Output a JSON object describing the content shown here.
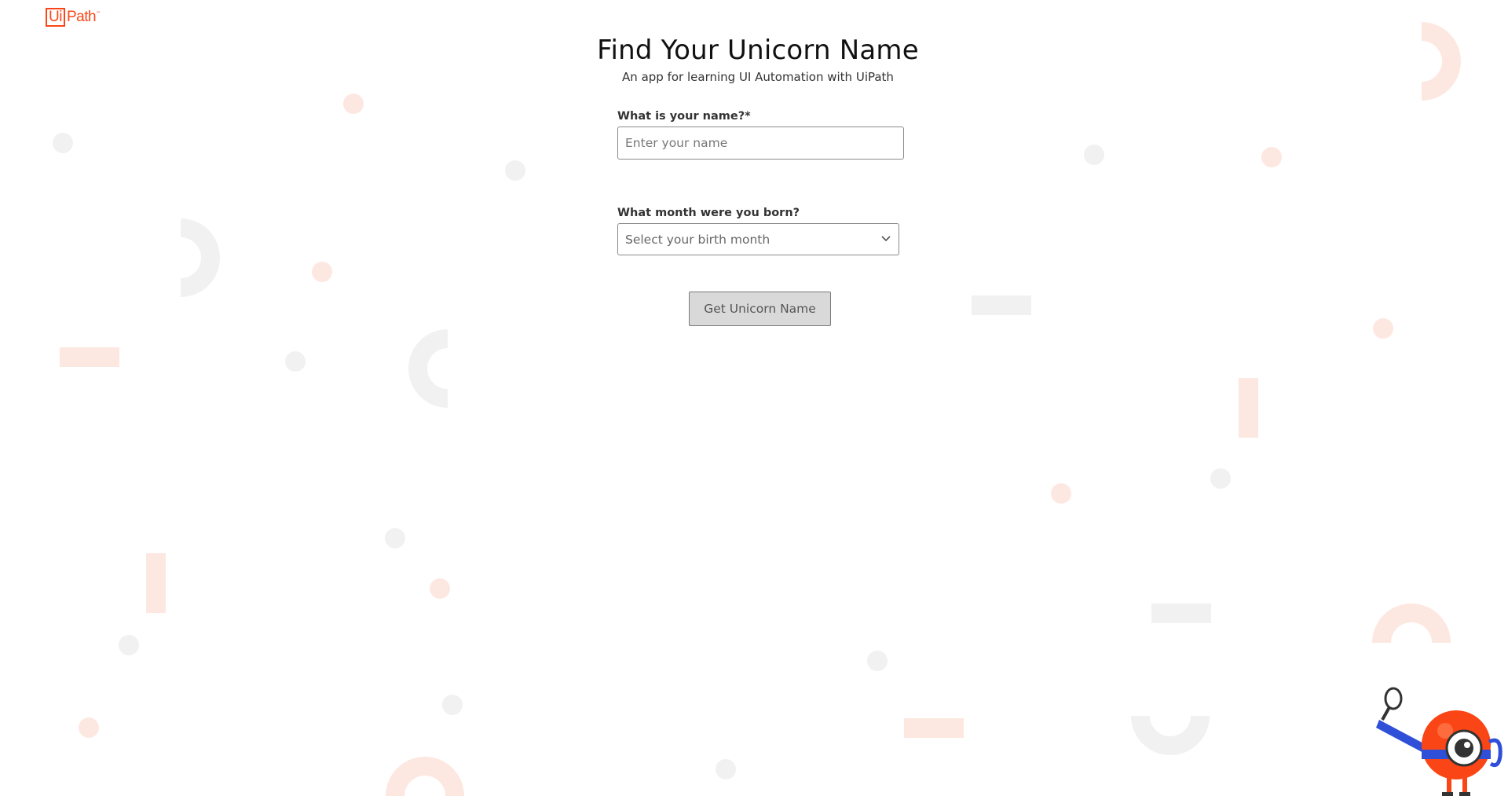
{
  "brand": {
    "logo_box_text": "Ui",
    "logo_text": "Path",
    "logo_tm": "™",
    "accent_color": "#fa4616"
  },
  "header": {
    "title": "Find Your Unicorn Name",
    "subtitle": "An app for learning UI Automation with UiPath"
  },
  "form": {
    "name_label": "What is your name?*",
    "name_value": "",
    "name_placeholder": "Enter your name",
    "month_label": "What month were you born?",
    "month_selected": "Select your birth month",
    "submit_label": "Get Unicorn Name"
  },
  "icons": {
    "dropdown": "chevron-down-icon",
    "mascot": "robot-mascot-with-magnifier"
  },
  "colors": {
    "decor_orange": "#fde8e1",
    "decor_gray": "#f1f1f1",
    "button_bg": "#d9d9d9"
  }
}
